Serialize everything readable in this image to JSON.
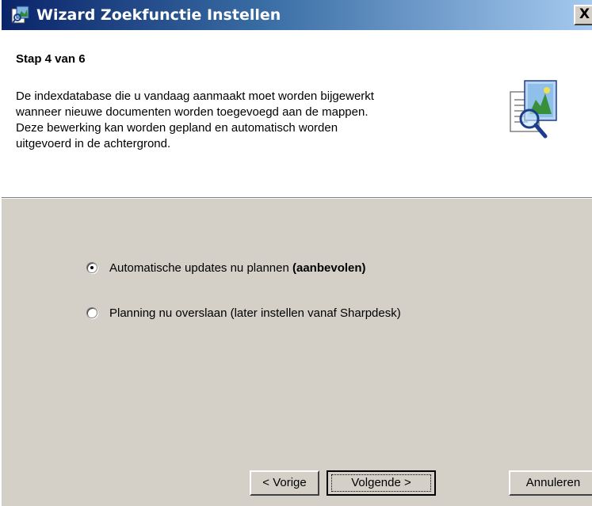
{
  "window": {
    "title": "Wizard Zoekfunctie Instellen",
    "close_label": "X"
  },
  "header": {
    "step": "Stap 4 van 6",
    "description_lines": [
      "De indexdatabase die u vandaag aanmaakt moet worden bijgewerkt",
      "wanneer nieuwe documenten worden toegevoegd aan de mappen.",
      "Deze bewerking kan worden gepland en automatisch worden",
      "uitgevoerd in de achtergrond."
    ]
  },
  "options": [
    {
      "label": "Automatische updates nu plannen ",
      "label_bold": "(aanbevolen)",
      "selected": true
    },
    {
      "label": "Planning nu overslaan (later instellen vanaf Sharpdesk)",
      "label_bold": "",
      "selected": false
    }
  ],
  "buttons": {
    "back": "< Vorige",
    "next": "Volgende >",
    "cancel": "Annuleren"
  },
  "icons": {
    "title_icon": "wizard-icon",
    "header_graphic": "search-document-icon"
  },
  "colors": {
    "dialog_bg": "#d4d0c8",
    "title_start": "#0a246a",
    "title_end": "#a6caf0"
  }
}
